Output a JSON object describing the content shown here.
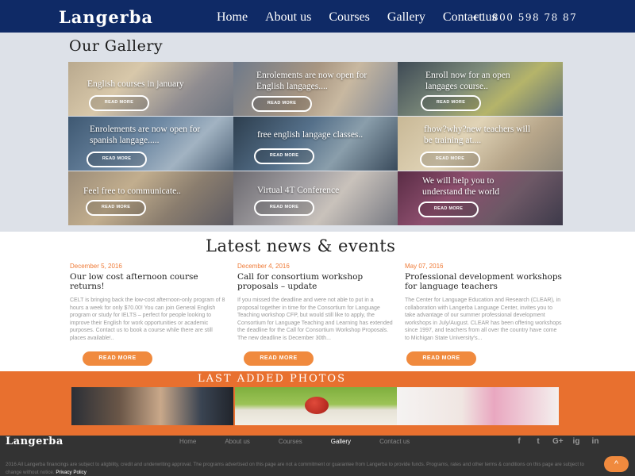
{
  "header": {
    "logo": "Langerba",
    "nav": [
      "Home",
      "About us",
      "Courses",
      "Gallery",
      "Contact us"
    ],
    "phone": "+1 800 598 78 87"
  },
  "gallery": {
    "title": "Our Gallery",
    "tiles": [
      {
        "caption": "English courses in january",
        "button": "READ MORE"
      },
      {
        "caption": "Enrolements are now open for\nEnglish langages....",
        "button": "READ MORE"
      },
      {
        "caption": "Enroll now  for an open\nlangages course..",
        "button": "READ MORE"
      },
      {
        "caption": "Enrolements are now open for\nspanish langage.....",
        "button": "READ MORE"
      },
      {
        "caption": "free english langage classes..",
        "button": "READ MORE"
      },
      {
        "caption": "fhow?why?new teachers will\nbe training at....",
        "button": "READ MORE"
      },
      {
        "caption": "Feel free  to communicate..",
        "button": "READ MORE"
      },
      {
        "caption": "Virtual 4T Conference",
        "button": "READ MORE"
      },
      {
        "caption": "We will help you to\nunderstand the world",
        "button": "READ MORE"
      }
    ]
  },
  "news": {
    "title": "Latest news & events",
    "items": [
      {
        "date": "December 5, 2016",
        "heading": "Our low cost afternoon course returns!",
        "body": "CELT is bringing back the low-cost afternoon-only program of 8 hours a week for only $70.00! You can join General English program or study for IELTS – perfect for people looking to improve their English for work opportunities or academic purposes. Contact us to book a course while there are still places available!..",
        "button": "READ MORE"
      },
      {
        "date": "December 4, 2016",
        "heading": "Call for consortium workshop proposals – update",
        "body": "If you missed the deadline and were not able to put in a proposal together in time for the Consortium for Language Teaching workshop CFP, but would still like to apply, the Consortium for Language Teaching and Learning has extended the deadline for the Call for Consortium Workshop Proposals. The new deadline is December 30th...",
        "button": "READ MORE"
      },
      {
        "date": "May 07, 2016",
        "heading": "Professional development workshops for language teachers",
        "body": "The Center for Language Education and Research (CLEAR), in collaboration with Langerba Language Center, invites you to take advantage of our summer professional development workshops in July/August. CLEAR has been offering workshops since 1997, and teachers from all over the country have come to Michigan State University's...",
        "button": "READ MORE"
      }
    ]
  },
  "photos": {
    "title": "LAST ADDED PHOTOS"
  },
  "footer": {
    "logo": "Langerba",
    "nav": [
      "Home",
      "About us",
      "Courses",
      "Gallery",
      "Contact us"
    ],
    "active": "Gallery",
    "social": [
      "f",
      "t",
      "G+",
      "ig",
      "in"
    ],
    "disclaimer": "2016  All Langerba financings are subject to aligbility, credit and underwriting approval. The programs advertised on this page are not a commitment or guarantee from Langerba to provide funds. Programs, rates and other terms & conditions on this page are subject to change without notice.",
    "privacy": "Privacy Policy",
    "scroll_top": "^"
  },
  "colors": {
    "header_bg": "#0f2a66",
    "accent_orange": "#f08a3e",
    "band_orange": "#e8702f",
    "gallery_bg": "#dde1e8",
    "footer_bg": "#333333"
  }
}
